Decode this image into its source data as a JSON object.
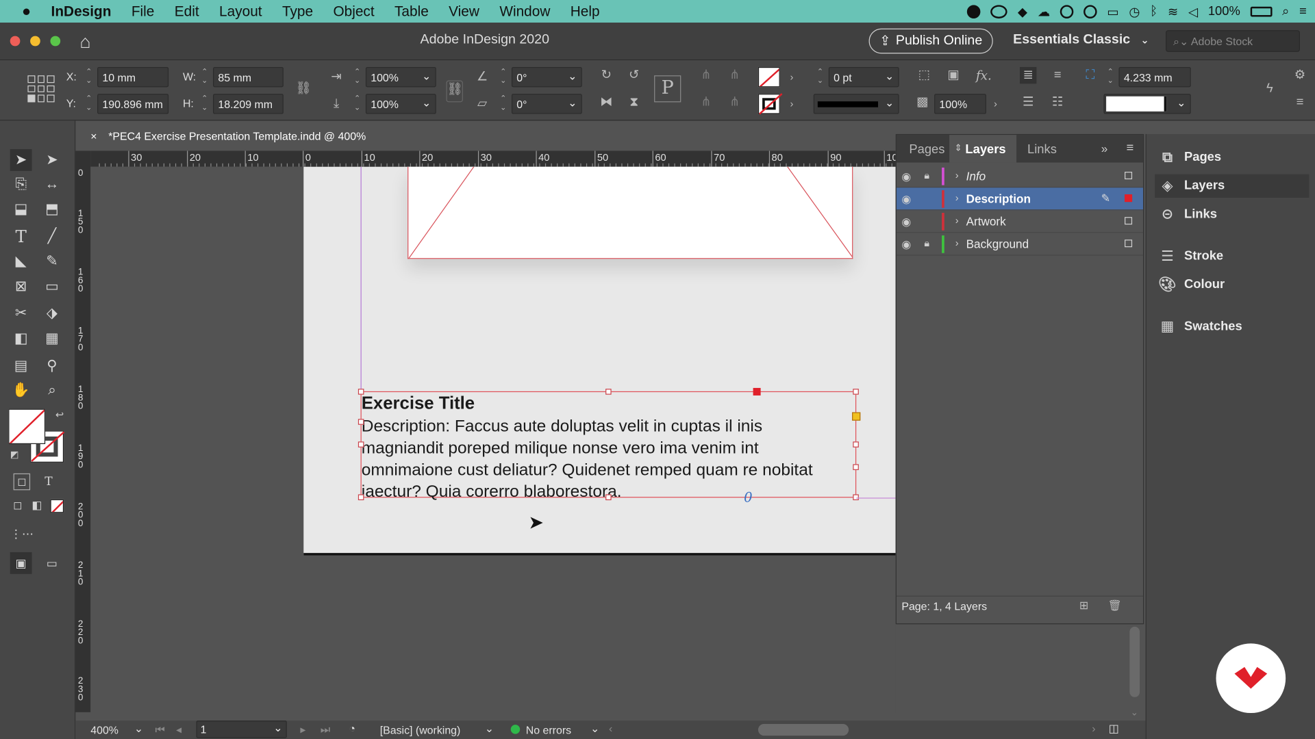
{
  "menubar": {
    "apple": "",
    "items": [
      "InDesign",
      "File",
      "Edit",
      "Layout",
      "Type",
      "Object",
      "Table",
      "View",
      "Window",
      "Help"
    ],
    "battery": "100%"
  },
  "titlebar": {
    "title": "Adobe InDesign 2020",
    "publish": "Publish Online",
    "workspace": "Essentials Classic",
    "stock_placeholder": "Adobe Stock"
  },
  "control": {
    "x_label": "X:",
    "x": "10 mm",
    "y_label": "Y:",
    "y": "190.896 mm",
    "w_label": "W:",
    "w": "85 mm",
    "h_label": "H:",
    "h": "18.209 mm",
    "scale_x": "100%",
    "scale_y": "100%",
    "rotate": "0°",
    "shear": "0°",
    "stroke_weight": "0 pt",
    "opacity": "100%",
    "spacing": "4.233 mm"
  },
  "document": {
    "tab": "*PEC4 Exercise Presentation Template.indd @ 400%",
    "tab_close": "×",
    "ruler_h": [
      "30",
      "20",
      "10",
      "0",
      "10",
      "20",
      "30",
      "40",
      "50",
      "60",
      "70",
      "80",
      "90",
      "10"
    ],
    "ruler_v": [
      "0",
      "150",
      "160",
      "170",
      "180",
      "190",
      "200",
      "210",
      "220",
      "230"
    ],
    "frame_title": "Exercise Title",
    "frame_desc": "Description: Faccus aute doluptas velit in cuptas il inis magniandit poreped milique nonse vero ima venim int omnimaione cust deliatur? Quidenet remped quam re nobitat iaectur? Quia corerro blaborestora.",
    "overset_mark": "0"
  },
  "status": {
    "zoom": "400%",
    "page": "1",
    "preflight_profile": "[Basic] (working)",
    "errors": "No errors"
  },
  "layers_panel": {
    "tabs": [
      "Pages",
      "Layers",
      "Links"
    ],
    "layers": [
      {
        "name": "Info",
        "color": "#d64fd6",
        "locked": true,
        "selected": false
      },
      {
        "name": "Description",
        "color": "#d0303a",
        "locked": false,
        "selected": true
      },
      {
        "name": "Artwork",
        "color": "#d0303a",
        "locked": false,
        "selected": false
      },
      {
        "name": "Background",
        "color": "#3ec43e",
        "locked": true,
        "selected": false
      }
    ],
    "footer": "Page: 1, 4 Layers"
  },
  "dock": {
    "items": [
      "Pages",
      "Layers",
      "Links",
      "Stroke",
      "Colour",
      "Swatches"
    ]
  }
}
